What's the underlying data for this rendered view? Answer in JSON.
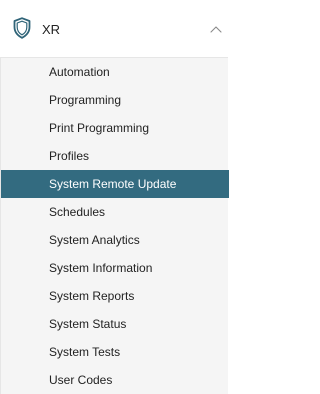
{
  "header": {
    "title": "XR",
    "icon": "shield-icon",
    "toggle_icon": "chevron-up-icon",
    "expanded": true
  },
  "menu": {
    "active_color": "#336b80",
    "active_index": 4,
    "items": [
      {
        "label": "Automation"
      },
      {
        "label": "Programming"
      },
      {
        "label": "Print Programming"
      },
      {
        "label": "Profiles"
      },
      {
        "label": "System Remote Update"
      },
      {
        "label": "Schedules"
      },
      {
        "label": "System Analytics"
      },
      {
        "label": "System Information"
      },
      {
        "label": "System Reports"
      },
      {
        "label": "System Status"
      },
      {
        "label": "System Tests"
      },
      {
        "label": "User Codes"
      }
    ]
  }
}
